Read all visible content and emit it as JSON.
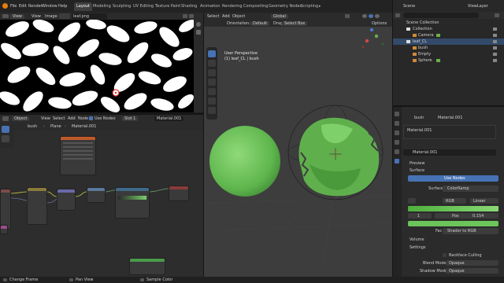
{
  "topbar": {
    "menus": [
      "File",
      "Edit",
      "Render",
      "Window",
      "Help"
    ],
    "workspaces": [
      "Layout",
      "Modeling",
      "Sculpting",
      "UV Editing",
      "Texture Paint",
      "Shading",
      "Animation",
      "Rendering",
      "Compositing",
      "Geometry Nodes",
      "Scripting"
    ],
    "active_workspace": "Layout",
    "scene_label": "Scene",
    "viewlayer_label": "ViewLayer"
  },
  "image_editor": {
    "view": "View",
    "menu_view": "View",
    "menu_image": "Image",
    "image_name": "leaf.png"
  },
  "node_editor": {
    "object_mode": "Object",
    "menus": [
      "View",
      "Select",
      "Add",
      "Node"
    ],
    "use_nodes": "Use Nodes",
    "slot": "Slot 1",
    "material": "Material.001",
    "breadcrumb": [
      "bush",
      "Plane",
      "Material.001"
    ]
  },
  "viewport": {
    "menus": [
      "Select",
      "Add",
      "Object"
    ],
    "global": "Global",
    "orientation_label": "Orientation:",
    "orientation_value": "Default",
    "drag_label": "Drag:",
    "drag_value": "Select Box",
    "options": "Options",
    "perspective": "User Perspective",
    "collection_info": "(1) leaf_CL | bush"
  },
  "outliner": {
    "root": "Scene Collection",
    "rows": [
      "Collection",
      "Camera",
      "leaf_CL",
      "bush",
      "Empty",
      "Sphere"
    ]
  },
  "properties": {
    "breadcrumb_obj": "bush",
    "breadcrumb_mat": "Material.001",
    "material_slot": "Material.001",
    "material_field": "Material.001",
    "preview": "Preview",
    "surface": "Surface",
    "use_nodes": "Use Nodes",
    "surface_label": "Surface",
    "surface_value": "ColorRamp",
    "ramp_mode": "RGB",
    "ramp_interp": "Linear",
    "pos_index": "1",
    "pos_label": "Pos",
    "pos_value": "0.154",
    "fac_label": "Fac",
    "fac_value": "Shader to RGB",
    "volume": "Volume",
    "settings": "Settings",
    "backface": "Backface Culling",
    "blend_mode_label": "Blend Mode",
    "blend_mode_value": "Opaque",
    "shadow_mode_label": "Shadow Mode",
    "shadow_mode_value": "Opaque"
  },
  "statusbar": {
    "left": "Change Frame",
    "mid": "Pan View",
    "right": "Sample Color"
  },
  "colors": {
    "accent": "#4772b3",
    "sphere_green": "#6cc45a",
    "active_tab": "#3f3f3f"
  }
}
